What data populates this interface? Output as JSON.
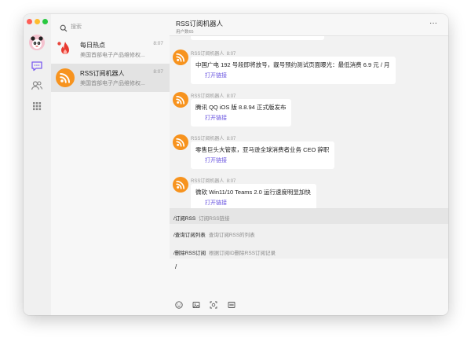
{
  "search": {
    "placeholder": "搜索"
  },
  "chats": [
    {
      "name": "每日热点",
      "preview": "美国首部电子产品维修权...",
      "time": "8:07",
      "icon": "fire-icon"
    },
    {
      "name": "RSS订阅机器人",
      "preview": "美国首部电子产品维修权...",
      "time": "8:07",
      "icon": "rss-icon",
      "active": true
    }
  ],
  "header": {
    "title": "RSS订阅机器人",
    "subtitle": "用户数65",
    "more": "···"
  },
  "messages": [
    {
      "sender": "RSS订阅机器人",
      "time": "8:07",
      "text": "中国广电 192 号段即将放号，靓号预约测试页面曝光：最低消费 6.9 元 / 月",
      "link": "打开链接"
    },
    {
      "sender": "RSS订阅机器人",
      "time": "8:07",
      "text": "腾讯 QQ iOS 版 8.8.94 正式版发布",
      "link": "打开链接"
    },
    {
      "sender": "RSS订阅机器人",
      "time": "8:07",
      "text": "零售巨头大管家，亚马逊全球消费者业务 CEO 辞职",
      "link": "打开链接"
    },
    {
      "sender": "RSS订阅机器人",
      "time": "8:07",
      "text": "微软 Win11/10 Teams 2.0 运行速度明显加快",
      "link": "打开链接"
    }
  ],
  "commands": [
    {
      "cmd": "/订阅RSS",
      "desc": "订阅RSS链接"
    },
    {
      "cmd": "/查询订阅列表",
      "desc": "查询订阅RSS的列表"
    },
    {
      "cmd": "/删除RSS订阅",
      "desc": "根据订阅ID删除RSS订阅记录"
    }
  ],
  "input": {
    "value": "/"
  },
  "icons": {
    "rail": [
      "chat-icon",
      "contacts-icon",
      "apps-icon"
    ],
    "toolbar": [
      "emoji-icon",
      "image-icon",
      "screenshot-icon",
      "command-icon"
    ]
  },
  "colors": {
    "accent": "#6a55e0",
    "rss": "#f7931e",
    "chat_active": "#7b5cf0"
  }
}
